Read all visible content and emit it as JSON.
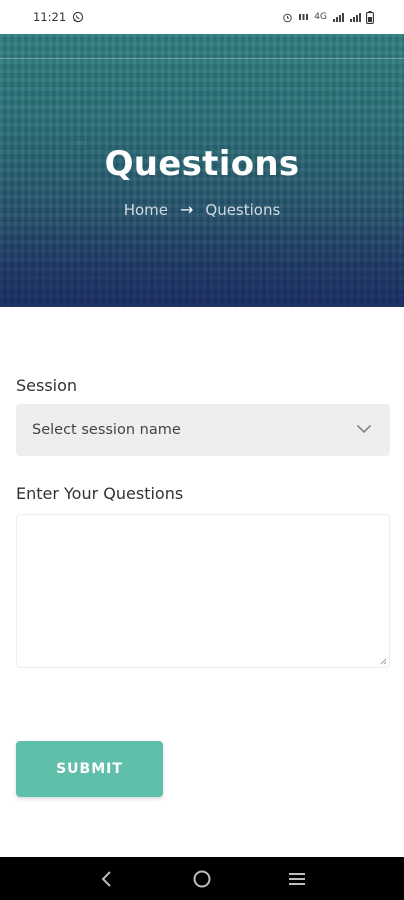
{
  "status_bar": {
    "time": "11:21",
    "network": "4G"
  },
  "hero": {
    "title": "Questions",
    "breadcrumb": {
      "home": "Home",
      "separator": "→",
      "current": "Questions"
    }
  },
  "form": {
    "session_label": "Session",
    "session_select_value": "Select session name",
    "questions_label": "Enter Your Questions",
    "questions_value": "",
    "submit_label": "SUBMIT"
  },
  "colors": {
    "accent": "#5fbfaa",
    "hero_top": "#2f7f80",
    "hero_bottom": "#1f3564"
  },
  "icons": {
    "whatsapp": "whatsapp-icon",
    "alarm": "alarm-icon",
    "signal": "signal-icon",
    "battery": "battery-icon",
    "chevron": "chevron-down-icon",
    "back": "back-icon",
    "home": "home-icon",
    "recents": "recents-icon"
  }
}
